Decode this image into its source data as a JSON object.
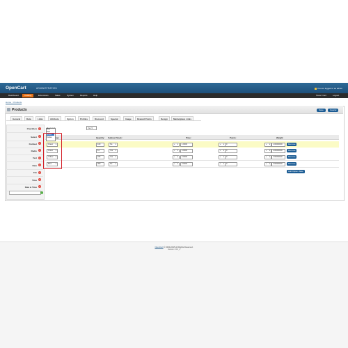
{
  "header": {
    "logo": "OpenCart",
    "subtitle": "ADMINISTRATION",
    "logged_in": "You are logged in as admin"
  },
  "menu": {
    "left": [
      "Dashboard",
      "Catalog",
      "Extensions",
      "Sales",
      "System",
      "Reports",
      "Help"
    ],
    "active": "Catalog",
    "right": [
      "Store Front",
      "Logout"
    ]
  },
  "breadcrumb": "Home :: Products",
  "page": {
    "title": "Products",
    "save": "Save",
    "cancel": "Cancel"
  },
  "tabs": [
    "General",
    "Data",
    "Links",
    "Attribute",
    "Option",
    "Profiles",
    "Discount",
    "Special",
    "Image",
    "Reward Points",
    "Design",
    "Marketplace Links"
  ],
  "active_tab": "Option",
  "options": [
    "Checkbox",
    "Select",
    "Fieldset",
    "Radio",
    "Text",
    "Date",
    "File",
    "Time",
    "Date & Time"
  ],
  "required": {
    "label": "Required:",
    "value": "Yes"
  },
  "table": {
    "headers": [
      "Option Value:",
      "Quantity:",
      "Subtract Stock:",
      "Price:",
      "Points:",
      "Weight:"
    ],
    "rows": [
      {
        "option": "Green",
        "qty": "100",
        "subtract": "No",
        "price_sign": "+",
        "price": "1.0000",
        "points_sign": "+",
        "points": "0",
        "weight_sign": "+",
        "weight": "1.00000000"
      },
      {
        "option": "Green",
        "qty": "61",
        "subtract": "Yes",
        "price_sign": "+",
        "price": "4.0000",
        "points_sign": "+",
        "points": "0",
        "weight_sign": "+",
        "weight": "4.00000000"
      },
      {
        "option": "Yellow",
        "qty": "226",
        "subtract": "Yes",
        "price_sign": "+",
        "price": "2.0000",
        "points_sign": "+",
        "points": "0",
        "weight_sign": "+",
        "weight": "2.00000000"
      },
      {
        "option": "Blue",
        "qty": "300",
        "subtract": "No",
        "price_sign": "+",
        "price": "3.0000",
        "points_sign": "+",
        "points": "0",
        "weight_sign": "+",
        "weight": "3.00000000"
      }
    ],
    "remove_label": "Remove",
    "add_label": "Add Option Value"
  },
  "dropdown": {
    "options": [
      "Blue",
      "Red",
      "Green",
      "Yellow"
    ],
    "selected": "Green"
  },
  "footer": {
    "line1_link": "OpenCart",
    "line1": "© 2009-2015 All Rights Reserved.",
    "line2": "Version 1.5.6_4"
  },
  "colors": {
    "header": "#2e6a97",
    "menu": "#2b2b2b",
    "active_menu": "#e57116",
    "button": "#1b5c94",
    "highlight_row": "#fbfbc5",
    "callout": "#d4232b"
  }
}
